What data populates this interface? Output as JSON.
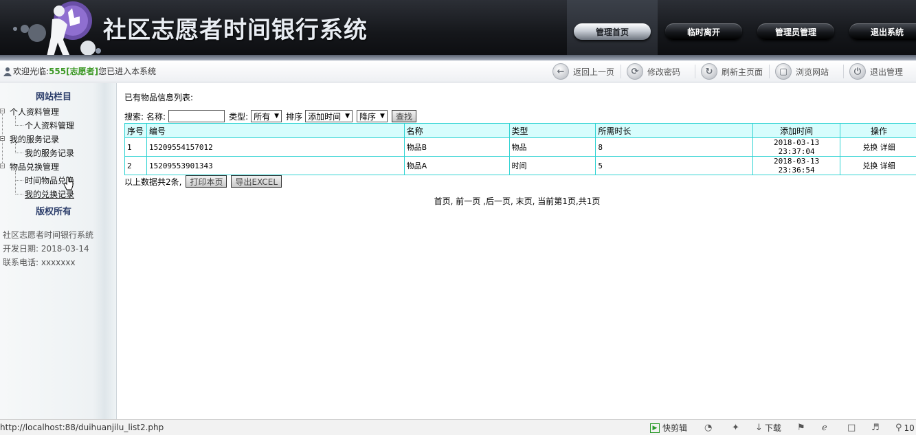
{
  "header": {
    "app_title": "社区志愿者时间银行系统",
    "nav": [
      {
        "label": "管理首页",
        "active": true
      },
      {
        "label": "临时离开",
        "active": false
      },
      {
        "label": "管理员管理",
        "active": false
      },
      {
        "label": "退出系统",
        "active": false
      }
    ]
  },
  "toolbar": {
    "welcome_prefix": "欢迎光临:",
    "username": "555[志愿者]",
    "welcome_suffix": "您已进入本系统",
    "tools": [
      {
        "label": "返回上一页",
        "icon": "back-arrow-icon"
      },
      {
        "label": "修改密码",
        "icon": "password-icon"
      },
      {
        "label": "刷新主页面",
        "icon": "refresh-icon"
      },
      {
        "label": "浏览网站",
        "icon": "browse-icon"
      },
      {
        "label": "退出管理",
        "icon": "power-icon"
      }
    ]
  },
  "sidebar": {
    "title": "网站栏目",
    "groups": [
      {
        "label": "个人资料管理",
        "children": [
          "个人资料管理"
        ]
      },
      {
        "label": "我的服务记录",
        "children": [
          "我的服务记录"
        ]
      },
      {
        "label": "物品兑换管理",
        "children": [
          "时间物品兑换",
          "我的兑换记录"
        ]
      }
    ],
    "copyright_title": "版权所有",
    "info": [
      "社区志愿者时间银行系统",
      "开发日期: 2018-03-14",
      "联系电话: xxxxxxx"
    ]
  },
  "main": {
    "list_title": "已有物品信息列表:",
    "search": {
      "prefix": "搜索:",
      "name_label": "名称:",
      "name_value": "",
      "type_label": "类型:",
      "type_value": "所有",
      "sort_label": "排序",
      "sort_field": "添加时间",
      "sort_order": "降序",
      "search_button": "查找"
    },
    "table": {
      "headers": [
        "序号",
        "编号",
        "名称",
        "类型",
        "所需时长",
        "添加时间",
        "操作"
      ],
      "rows": [
        {
          "index": "1",
          "code": "15209554157012",
          "name": "物品B",
          "type": "物品",
          "hours": "8",
          "time": "2018-03-13 23:37:04",
          "op1": "兑换",
          "op2": "详细"
        },
        {
          "index": "2",
          "code": "15209553901343",
          "name": "物品A",
          "type": "时间",
          "hours": "5",
          "time": "2018-03-13 23:36:54",
          "op1": "兑换",
          "op2": "详细"
        }
      ]
    },
    "summary": "以上数据共2条,",
    "print_button": "打印本页",
    "export_button": "导出EXCEL",
    "pager": {
      "first": "首页,",
      "prev": "前一页",
      "next": ",后一页,",
      "last": "末页,",
      "current": "当前第1页,共1页"
    }
  },
  "statusbar": {
    "url": "http://localhost:88/duihuanjilu_list2.php",
    "quick_edit": "快剪辑",
    "download": "下载",
    "zoom": "10"
  }
}
